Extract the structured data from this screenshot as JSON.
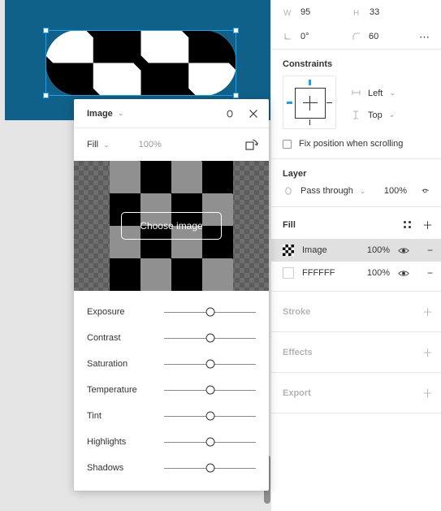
{
  "app": {
    "name": "design-editor",
    "accent": "#1aa0f0",
    "canvas_bg": "#0f6189"
  },
  "canvas": {
    "artboard_color": "#0f6189",
    "selection": {
      "visible": true
    }
  },
  "properties": {
    "dimensions": {
      "width_icon": "width-icon",
      "width_label": "W",
      "width_value": "95",
      "height_icon": "height-icon",
      "height_label": "H",
      "height_value": "33",
      "rotation_icon": "angle-icon",
      "rotation_value": "0°",
      "corner_icon": "corner-radius-icon",
      "corner_value": "60",
      "more_label": "⋯"
    },
    "constraints": {
      "title": "Constraints",
      "horizontal": "Left",
      "vertical": "Top",
      "fix_position_label": "Fix position when scrolling",
      "fix_position_checked": false
    },
    "layer": {
      "title": "Layer",
      "blend_mode": "Pass through",
      "opacity": "100%"
    },
    "fill": {
      "title": "Fill",
      "items": [
        {
          "type": "image",
          "name": "Image",
          "opacity": "100%",
          "selected": true
        },
        {
          "type": "solid",
          "name": "FFFFFF",
          "opacity": "100%",
          "selected": false
        }
      ]
    },
    "collapsed": [
      {
        "title": "Stroke"
      },
      {
        "title": "Effects"
      },
      {
        "title": "Export"
      }
    ]
  },
  "image_popover": {
    "title": "Image",
    "fill_mode": "Fill",
    "fill_opacity": "100%",
    "choose_button": "Choose image",
    "adjustments": [
      {
        "label": "Exposure",
        "value": 50
      },
      {
        "label": "Contrast",
        "value": 50
      },
      {
        "label": "Saturation",
        "value": 50
      },
      {
        "label": "Temperature",
        "value": 50
      },
      {
        "label": "Tint",
        "value": 50
      },
      {
        "label": "Highlights",
        "value": 50
      },
      {
        "label": "Shadows",
        "value": 50
      }
    ]
  }
}
